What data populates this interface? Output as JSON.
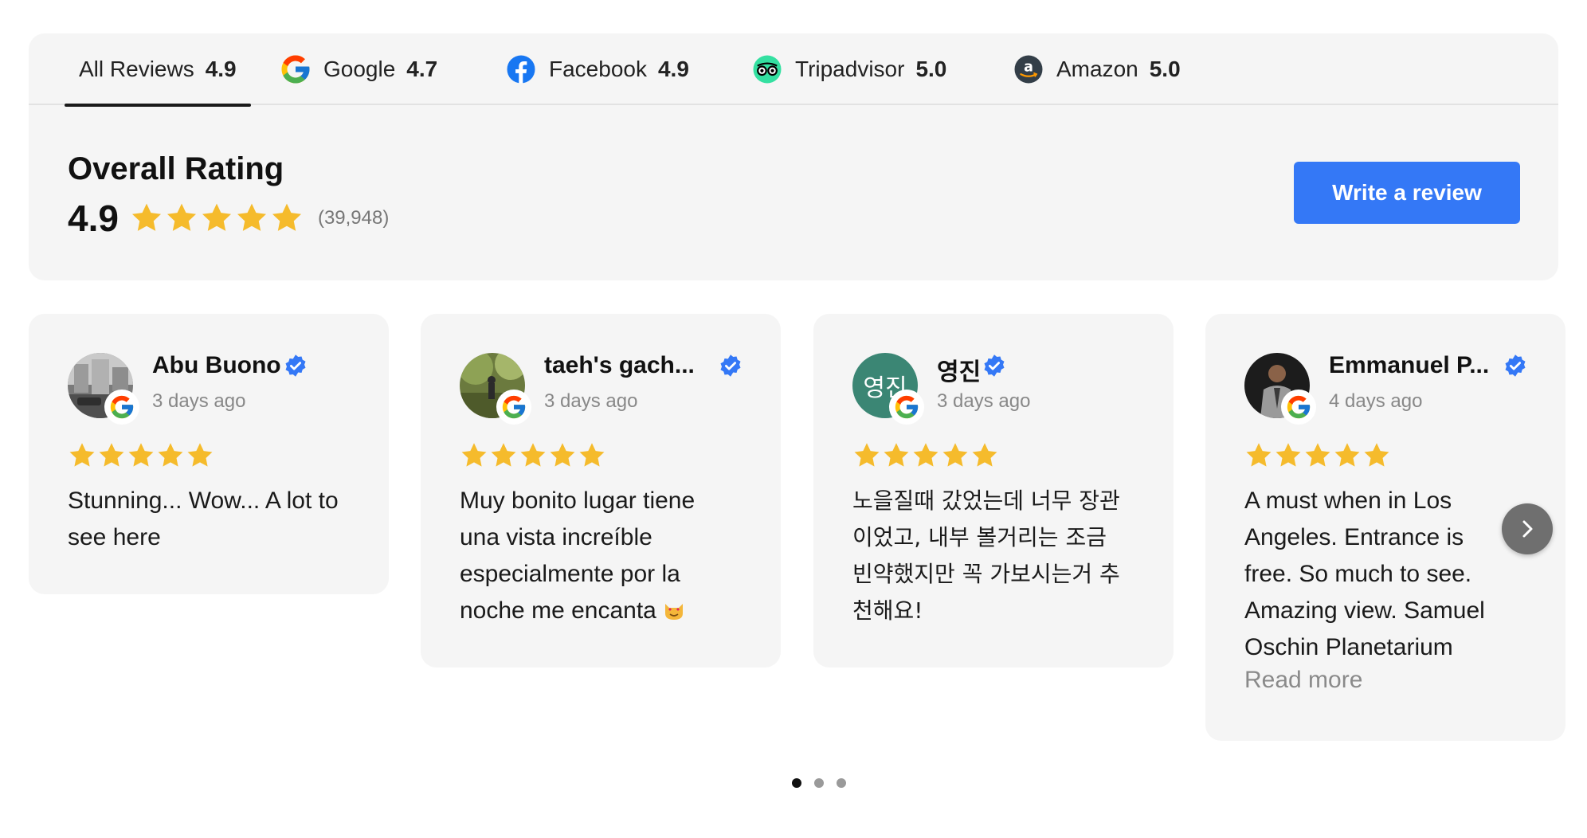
{
  "tabs": [
    {
      "label": "All Reviews",
      "score": "4.9",
      "icon": "none",
      "active": true
    },
    {
      "label": "Google",
      "score": "4.7",
      "icon": "google-icon"
    },
    {
      "label": "Facebook",
      "score": "4.9",
      "icon": "facebook-icon"
    },
    {
      "label": "Tripadvisor",
      "score": "5.0",
      "icon": "tripadvisor-icon"
    },
    {
      "label": "Amazon",
      "score": "5.0",
      "icon": "amazon-icon"
    }
  ],
  "overall": {
    "title": "Overall Rating",
    "score": "4.9",
    "stars": 5,
    "count": "(39,948)"
  },
  "write_review_label": "Write a review",
  "reviews": [
    {
      "name": "Abu Buono",
      "date": "3 days ago",
      "stars": 5,
      "source": "google-icon",
      "text": "Stunning... Wow... A lot to see here"
    },
    {
      "name": "taeh's gach...",
      "date": "3 days ago",
      "stars": 5,
      "source": "google-icon",
      "text": "Muy bonito lugar tiene una vista increíble especialmente por la noche me encanta"
    },
    {
      "name": "영진",
      "avatar_letters": "영진",
      "date": "3 days ago",
      "stars": 5,
      "source": "google-icon",
      "text": "노을질때 갔었는데 너무 장관이었고, 내부 볼거리는 조금 빈약했지만 꼭 가보시는거 추천해요!"
    },
    {
      "name": "Emmanuel P...",
      "date": "4 days ago",
      "stars": 5,
      "source": "google-icon",
      "text": "A must when in Los Angeles. Entrance is free. So much to see. Amazing view. Samuel Oschin Planetarium",
      "read_more": "Read more"
    }
  ],
  "pager": {
    "pages": 3,
    "current": 1
  },
  "colors": {
    "star": "#f5bb2c",
    "button": "#3478f6",
    "verified": "#3478f6",
    "panel": "#f5f5f5"
  }
}
